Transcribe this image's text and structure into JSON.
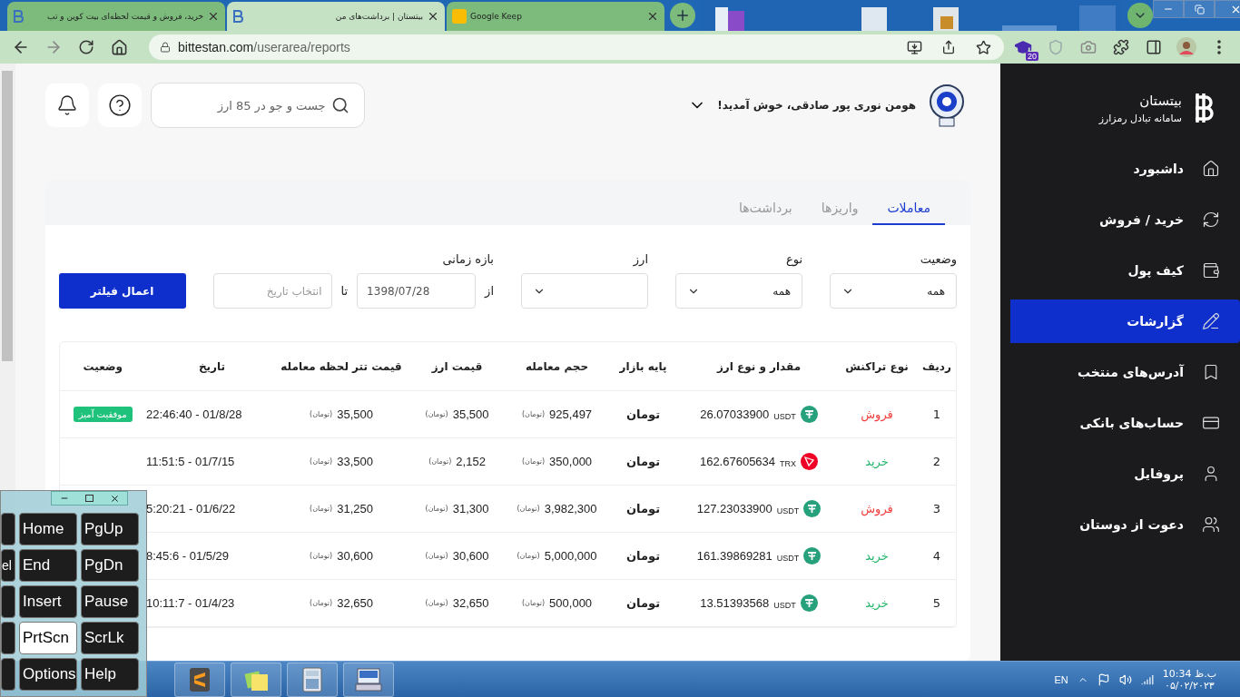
{
  "browser": {
    "tabs": [
      {
        "title": "Google Keep",
        "kind": "keep",
        "selected": false
      },
      {
        "title": "بیتستان | برداشت‌های من",
        "kind": "site",
        "selected": true
      },
      {
        "title": "خرید، فروش و قیمت لحظه‌ای بیت کوین و تب",
        "kind": "site",
        "selected": false
      }
    ],
    "url_host": "bittestan.com",
    "url_path": "/userarea/reports",
    "extension_badge": "20"
  },
  "header": {
    "welcome": "هومن نوری پور صادقی، خوش آمدید!",
    "search_placeholder": "جست و جو در 85 ارز"
  },
  "tabs": [
    {
      "label": "معاملات",
      "selected": true
    },
    {
      "label": "واریزها",
      "selected": false
    },
    {
      "label": "برداشت‌ها",
      "selected": false
    }
  ],
  "filters": {
    "status": {
      "label": "وضعیت",
      "value": "همه"
    },
    "type": {
      "label": "نوع",
      "value": "همه"
    },
    "currency": {
      "label": "ارز"
    },
    "range": {
      "label": "بازه زمانی",
      "from_label": "از",
      "from_value": "1398/07/28",
      "to_label": "تا",
      "to_placeholder": "انتخاب تاریخ"
    },
    "apply": "اعمال فیلتر"
  },
  "table": {
    "columns": [
      "ردیف",
      "نوع تراکنش",
      "مقدار و نوع ارز",
      "پایه بازار",
      "حجم معامله",
      "قیمت ارز",
      "قیمت تتر لحظه معامله",
      "تاریخ",
      "وضعیت"
    ],
    "rows": [
      {
        "index": "1",
        "kind": "sell",
        "type": "فروش",
        "amount": "26.07033900",
        "coin": {
          "symbol": "USDT",
          "kind": "usdt"
        },
        "base": "تومان",
        "volume": {
          "value": "925,497",
          "unit": "(تومان)"
        },
        "price": {
          "value": "35,500",
          "unit": "(تومان)"
        },
        "tether": {
          "value": "35,500",
          "unit": "(تومان)"
        },
        "date": "22:46:40 - 01/8/28",
        "status": "موفقیت آمیز"
      },
      {
        "index": "2",
        "kind": "buy",
        "type": "خرید",
        "amount": "162.67605634",
        "coin": {
          "symbol": "TRX",
          "kind": "trx"
        },
        "base": "تومان",
        "volume": {
          "value": "350,000",
          "unit": "(تومان)"
        },
        "price": {
          "value": "2,152",
          "unit": "(تومان)"
        },
        "tether": {
          "value": "33,500",
          "unit": "(تومان)"
        },
        "date": "11:51:5 - 01/7/15"
      },
      {
        "index": "3",
        "kind": "sell",
        "type": "فروش",
        "amount": "127.23033900",
        "coin": {
          "symbol": "USDT",
          "kind": "usdt"
        },
        "base": "تومان",
        "volume": {
          "value": "3,982,300",
          "unit": "(تومان)"
        },
        "price": {
          "value": "31,300",
          "unit": "(تومان)"
        },
        "tether": {
          "value": "31,250",
          "unit": "(تومان)"
        },
        "date": "5:20:21 - 01/6/22"
      },
      {
        "index": "4",
        "kind": "buy",
        "type": "خرید",
        "amount": "161.39869281",
        "coin": {
          "symbol": "USDT",
          "kind": "usdt"
        },
        "base": "تومان",
        "volume": {
          "value": "5,000,000",
          "unit": "(تومان)"
        },
        "price": {
          "value": "30,600",
          "unit": "(تومان)"
        },
        "tether": {
          "value": "30,600",
          "unit": "(تومان)"
        },
        "date": "8:45:6 - 01/5/29"
      },
      {
        "index": "5",
        "kind": "buy",
        "type": "خرید",
        "amount": "13.51393568",
        "coin": {
          "symbol": "USDT",
          "kind": "usdt"
        },
        "base": "تومان",
        "volume": {
          "value": "500,000",
          "unit": "(تومان)"
        },
        "price": {
          "value": "32,650",
          "unit": "(تومان)"
        },
        "tether": {
          "value": "32,650",
          "unit": "(تومان)"
        },
        "date": "10:11:7 - 01/4/23"
      }
    ]
  },
  "sidebar": {
    "brand": "بیتستان",
    "subtitle": "سامانه تبادل رمزارز",
    "items": [
      {
        "label": "داشبورد",
        "kind": "home",
        "selected": false
      },
      {
        "label": "خرید / فروش",
        "kind": "exchange",
        "selected": false
      },
      {
        "label": "کیف پول",
        "kind": "wallet",
        "selected": false
      },
      {
        "label": "گزارشات",
        "kind": "reports",
        "selected": true
      },
      {
        "label": "آدرس‌های منتخب",
        "kind": "bookmark",
        "selected": false
      },
      {
        "label": "حساب‌های بانکی",
        "kind": "card",
        "selected": false
      },
      {
        "label": "پروفایل",
        "kind": "profile",
        "selected": false
      },
      {
        "label": "دعوت از دوستان",
        "kind": "invite",
        "selected": false
      }
    ]
  },
  "keyboard": {
    "edge_keys": [
      {
        "selected": false
      },
      {
        "label": "el",
        "selected": false
      },
      {
        "selected": false
      },
      {
        "selected": false
      },
      {
        "selected": false
      }
    ],
    "keys": [
      {
        "label": "PgUp",
        "selected": false
      },
      {
        "label": "Home",
        "selected": false
      },
      {
        "label": "PgDn",
        "selected": false
      },
      {
        "label": "End",
        "selected": false
      },
      {
        "label": "Pause",
        "selected": false
      },
      {
        "label": "Insert",
        "selected": false
      },
      {
        "label": "ScrLk",
        "selected": false
      },
      {
        "label": "PrtScn",
        "selected": true
      },
      {
        "label": "Help",
        "selected": false
      },
      {
        "label": "Options",
        "selected": false
      }
    ]
  },
  "taskbar": {
    "apps": [
      {
        "kind": "editor"
      },
      {
        "kind": "notes"
      },
      {
        "kind": "calculator"
      },
      {
        "kind": "keyboard"
      }
    ],
    "language": "EN",
    "time": "ب.ظ 10:34",
    "date": "۰۵/۰۲/۲۰۲۳"
  }
}
